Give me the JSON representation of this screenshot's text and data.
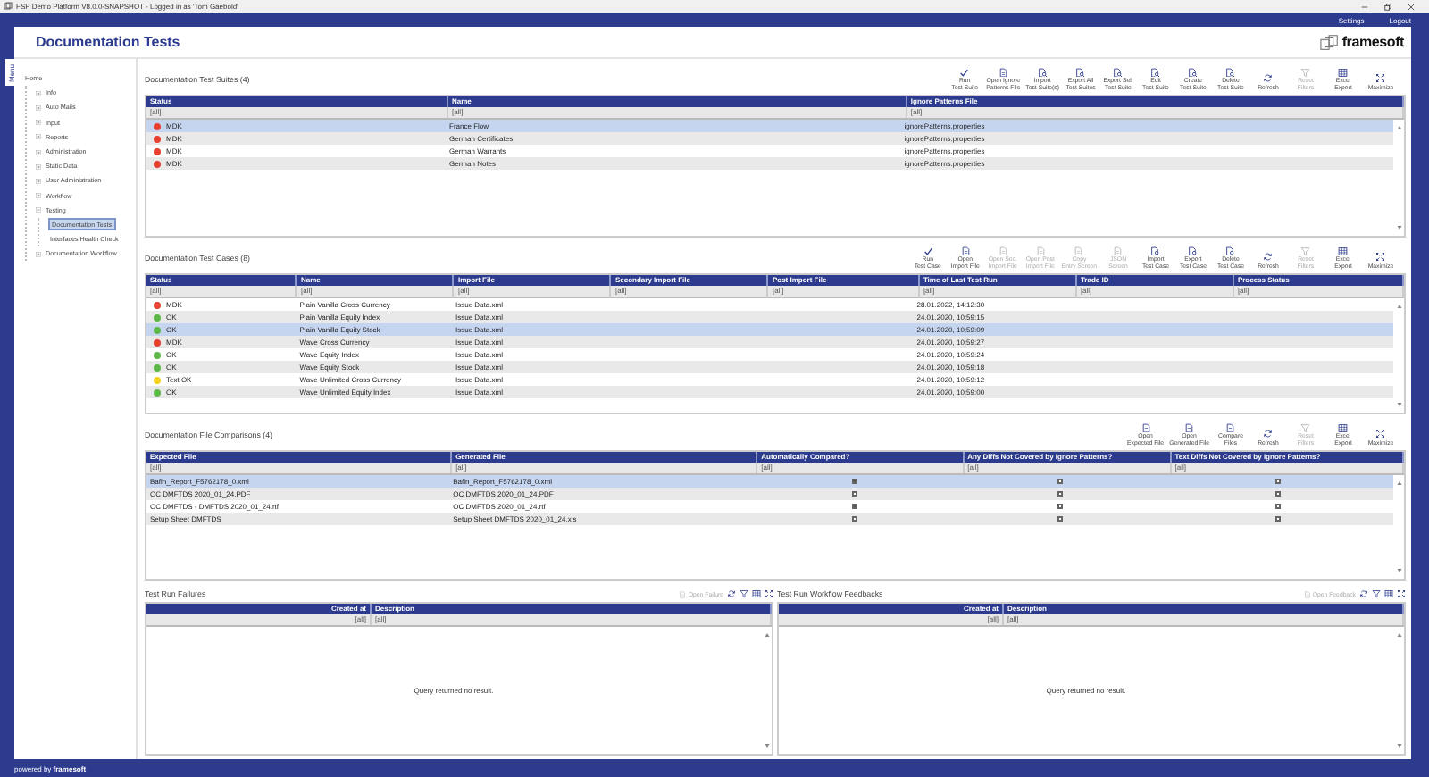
{
  "window": {
    "title": "FSP Demo Platform V8.0.0-SNAPSHOT - Logged in as 'Tom Gaebold'"
  },
  "top_links": [
    "Settings",
    "Logout"
  ],
  "page": {
    "title": "Documentation Tests",
    "logo": "framesoft"
  },
  "menu_tab": "Menu",
  "sidebar": {
    "items": [
      {
        "label": "Home",
        "selected": false,
        "children": [
          {
            "label": "Info",
            "expanded": false,
            "selected": false
          },
          {
            "label": "Auto Mails",
            "expanded": false,
            "selected": false
          },
          {
            "label": "Input",
            "expanded": false,
            "selected": false
          },
          {
            "label": "Reports",
            "expanded": false,
            "selected": false
          },
          {
            "label": "Administration",
            "expanded": false,
            "selected": false
          },
          {
            "label": "Static Data",
            "expanded": false,
            "selected": false
          },
          {
            "label": "User Administration",
            "expanded": false,
            "selected": false
          },
          {
            "label": "Workflow",
            "expanded": false,
            "selected": false
          },
          {
            "label": "Testing",
            "expanded": true,
            "selected": false,
            "children": [
              {
                "label": "Documentation Tests",
                "selected": true
              },
              {
                "label": "Interfaces Health Check",
                "selected": false
              }
            ]
          },
          {
            "label": "Documentation Workflow",
            "expanded": false,
            "selected": false
          }
        ]
      }
    ]
  },
  "panels": [
    {
      "title": "Documentation Test Suites  (4)",
      "toolbar": [
        {
          "label": "Run\nTest Suite",
          "kind": "check",
          "disabled": false
        },
        {
          "label": "Open Ignore\nPatterns File",
          "kind": "doc",
          "disabled": false
        },
        {
          "label": "Import\nTest Suite(s)",
          "kind": "docsearch",
          "disabled": false
        },
        {
          "label": "Export All\nTest Suites",
          "kind": "docsearch",
          "disabled": false
        },
        {
          "label": "Export Sel.\nTest Suite",
          "kind": "docsearch",
          "disabled": false
        },
        {
          "label": "Edit\nTest Suite",
          "kind": "docsearch",
          "disabled": false
        },
        {
          "label": "Create\nTest Suite",
          "kind": "docsearch",
          "disabled": false
        },
        {
          "label": "Delete\nTest Suite",
          "kind": "docsearch",
          "disabled": false
        },
        {
          "label": "Refresh",
          "kind": "refresh",
          "disabled": false
        },
        {
          "label": "Reset\nFilters",
          "kind": "funnel",
          "disabled": true
        },
        {
          "label": "Excel\nExport",
          "kind": "sheet",
          "disabled": false
        },
        {
          "label": "Maximize",
          "kind": "maximize",
          "disabled": false
        }
      ],
      "columns": [
        {
          "label": "Status",
          "kind": "status",
          "filter": "[all]"
        },
        {
          "label": "Name",
          "kind": "text",
          "filter": "[all]"
        },
        {
          "label": "Ignore Patterns File",
          "kind": "text",
          "filter": "[all]"
        }
      ],
      "rows": [
        {
          "selected": true,
          "color": "#e8402f",
          "cells": [
            "MDK",
            "France Flow",
            "ignorePatterns.properties"
          ]
        },
        {
          "selected": false,
          "color": "#e8402f",
          "cells": [
            "MDK",
            "German Certificates",
            "ignorePatterns.properties"
          ]
        },
        {
          "selected": false,
          "color": "#e8402f",
          "cells": [
            "MDK",
            "German Warrants",
            "ignorePatterns.properties"
          ]
        },
        {
          "selected": false,
          "color": "#e8402f",
          "cells": [
            "MDK",
            "German Notes",
            "ignorePatterns.properties"
          ]
        }
      ]
    },
    {
      "title": "Documentation Test Cases  (8)",
      "toolbar": [
        {
          "label": "Run\nTest Case",
          "kind": "check",
          "disabled": false
        },
        {
          "label": "Open\nImport File",
          "kind": "doc",
          "disabled": false
        },
        {
          "label": "Open Sec.\nImport File",
          "kind": "doc",
          "disabled": true
        },
        {
          "label": "Open Post\nImport File",
          "kind": "doc",
          "disabled": true
        },
        {
          "label": "Copy\nEntry Screen",
          "kind": "doc",
          "disabled": true
        },
        {
          "label": "JSON\nScreen",
          "kind": "doc",
          "disabled": true
        },
        {
          "label": "Import\nTest Case",
          "kind": "docsearch",
          "disabled": false
        },
        {
          "label": "Export\nTest Case",
          "kind": "docsearch",
          "disabled": false
        },
        {
          "label": "Delete\nTest Case",
          "kind": "docsearch",
          "disabled": false
        },
        {
          "label": "Refresh",
          "kind": "refresh",
          "disabled": false
        },
        {
          "label": "Reset\nFilters",
          "kind": "funnel",
          "disabled": true
        },
        {
          "label": "Excel\nExport",
          "kind": "sheet",
          "disabled": false
        },
        {
          "label": "Maximize",
          "kind": "maximize",
          "disabled": false
        }
      ],
      "columns": [
        {
          "label": "Status",
          "kind": "status",
          "filter": "[all]"
        },
        {
          "label": "Name",
          "kind": "text",
          "filter": "[all]"
        },
        {
          "label": "Import File",
          "kind": "text",
          "filter": "[all]"
        },
        {
          "label": "Secondary Import File",
          "kind": "text",
          "filter": "[all]"
        },
        {
          "label": "Post Import File",
          "kind": "text",
          "filter": "[all]"
        },
        {
          "label": "Time of Last Test Run",
          "kind": "text",
          "filter": "[all]"
        },
        {
          "label": "Trade ID",
          "kind": "text",
          "filter": "[all]"
        },
        {
          "label": "Process Status",
          "kind": "text",
          "filter": "[all]"
        }
      ],
      "rows": [
        {
          "selected": false,
          "color": "#e8402f",
          "cells": [
            "MDK",
            "Plain Vanilla Cross Currency",
            "Issue Data.xml",
            "",
            "",
            "28.01.2022, 14:12:30"
          ]
        },
        {
          "selected": false,
          "color": "#5cb847",
          "cells": [
            "OK",
            "Plain Vanilla Equity Index",
            "Issue Data.xml",
            "",
            "",
            "24.01.2020, 10:59:15"
          ]
        },
        {
          "selected": true,
          "color": "#5cb847",
          "cells": [
            "OK",
            "Plain Vanilla Equity Stock",
            "Issue Data.xml",
            "",
            "",
            "24.01.2020, 10:59:09"
          ]
        },
        {
          "selected": false,
          "color": "#e8402f",
          "cells": [
            "MDK",
            "Wave Cross Currency",
            "Issue Data.xml",
            "",
            "",
            "24.01.2020, 10:59:27"
          ]
        },
        {
          "selected": false,
          "color": "#5cb847",
          "cells": [
            "OK",
            "Wave Equity Index",
            "Issue Data.xml",
            "",
            "",
            "24.01.2020, 10:59:24"
          ]
        },
        {
          "selected": false,
          "color": "#5cb847",
          "cells": [
            "OK",
            "Wave Equity Stock",
            "Issue Data.xml",
            "",
            "",
            "24.01.2020, 10:59:18"
          ]
        },
        {
          "selected": false,
          "color": "#f2d21b",
          "cells": [
            "Text OK",
            "Wave Unlimited Cross Currency",
            "Issue Data.xml",
            "",
            "",
            "24.01.2020, 10:59:12"
          ]
        },
        {
          "selected": false,
          "color": "#5cb847",
          "cells": [
            "OK",
            "Wave Unlimited Equity Index",
            "Issue Data.xml",
            "",
            "",
            "24.01.2020, 10:59:00"
          ]
        }
      ]
    },
    {
      "title": "Documentation File Comparisons  (4)",
      "toolbar": [
        {
          "label": "Open\nExpected File",
          "kind": "doc",
          "disabled": false
        },
        {
          "label": "Open\nGenerated File",
          "kind": "doc",
          "disabled": false
        },
        {
          "label": "Compare\nFiles",
          "kind": "doc",
          "disabled": false
        },
        {
          "label": "Refresh",
          "kind": "refresh",
          "disabled": false
        },
        {
          "label": "Reset\nFilters",
          "kind": "funnel",
          "disabled": true
        },
        {
          "label": "Excel\nExport",
          "kind": "sheet",
          "disabled": false
        },
        {
          "label": "Maximize",
          "kind": "maximize",
          "disabled": false
        }
      ],
      "columns": [
        {
          "label": "Expected File",
          "kind": "text",
          "filter": "[all]"
        },
        {
          "label": "Generated File",
          "kind": "text",
          "filter": "[all]"
        },
        {
          "label": "Automatically Compared?",
          "kind": "check",
          "filter": "[all]"
        },
        {
          "label": "Any Diffs Not Covered by Ignore Patterns?",
          "kind": "check",
          "filter": "[all]"
        },
        {
          "label": "Text Diffs Not Covered by Ignore Patterns?",
          "kind": "check",
          "filter": "[all]"
        }
      ],
      "rows": [
        {
          "selected": true,
          "cells": [
            "Bafin_Report_F5762178_0.xml",
            "Bafin_Report_F5762178_0.xml",
            true,
            false,
            false
          ]
        },
        {
          "selected": false,
          "cells": [
            "OC DMFTDS 2020_01_24.PDF",
            "OC DMFTDS 2020_01_24.PDF",
            false,
            false,
            false
          ]
        },
        {
          "selected": false,
          "cells": [
            "OC DMFTDS - DMFTDS 2020_01_24.rtf",
            "OC DMFTDS 2020_01_24.rtf",
            true,
            false,
            false
          ]
        },
        {
          "selected": false,
          "cells": [
            "Setup Sheet DMFTDS",
            "Setup Sheet DMFTDS 2020_01_24.xls",
            false,
            false,
            false
          ]
        }
      ]
    }
  ],
  "bottom_panels": [
    {
      "title": "Test Run Failures",
      "action": {
        "label": "Open Failure",
        "disabled": true
      },
      "tools": [
        {
          "kind": "refresh"
        },
        {
          "kind": "funnel"
        },
        {
          "kind": "sheet"
        },
        {
          "kind": "maximize"
        }
      ],
      "columns": [
        {
          "label": "Created at",
          "filter": "[all]"
        },
        {
          "label": "Description",
          "filter": "[all]"
        }
      ],
      "empty_message": "Query returned no result."
    },
    {
      "title": "Test Run Workflow Feedbacks",
      "action": {
        "label": "Open Feedback",
        "disabled": true
      },
      "tools": [
        {
          "kind": "refresh"
        },
        {
          "kind": "funnel"
        },
        {
          "kind": "sheet"
        },
        {
          "kind": "maximize"
        }
      ],
      "columns": [
        {
          "label": "Created at",
          "filter": "[all]"
        },
        {
          "label": "Description",
          "filter": "[all]"
        }
      ],
      "empty_message": "Query returned no result."
    }
  ],
  "status_bar": {
    "text": "powered by **framesoft**"
  }
}
